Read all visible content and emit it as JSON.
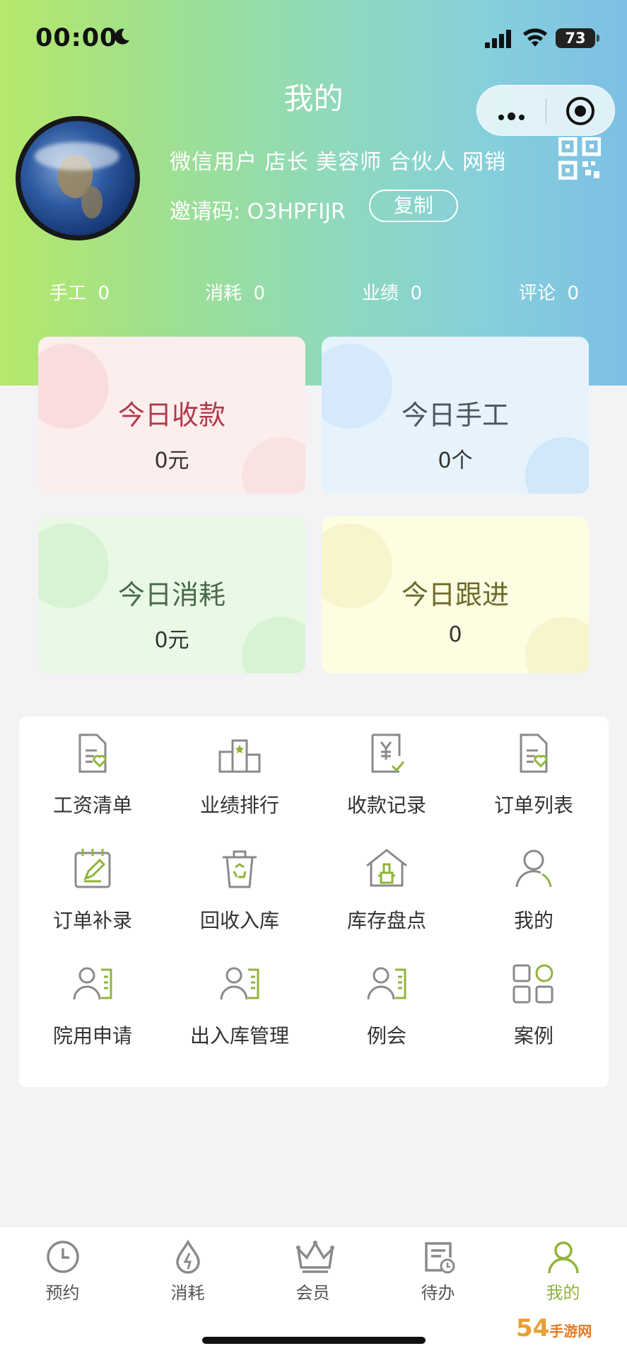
{
  "status_bar": {
    "time": "00:00",
    "battery": "73"
  },
  "header": {
    "title": "我的"
  },
  "profile": {
    "roles": "微信用户 店长 美容师 合伙人 网销",
    "invite_label": "邀请码: ",
    "invite_code": "O3HPFIJR",
    "copy_label": "复制"
  },
  "stats": [
    {
      "label": "手工",
      "value": "0"
    },
    {
      "label": "消耗",
      "value": "0"
    },
    {
      "label": "业绩",
      "value": "0"
    },
    {
      "label": "评论",
      "value": "0"
    }
  ],
  "cards": [
    {
      "title": "今日收款",
      "value": "0元",
      "color": "#b03a4a",
      "bg": "#fdeeee"
    },
    {
      "title": "今日手工",
      "value": "0个",
      "color": "#4a5560",
      "bg": "#e6f3fc"
    },
    {
      "title": "今日消耗",
      "value": "0元",
      "color": "#4a6a4a",
      "bg": "#e9f9e6"
    },
    {
      "title": "今日跟进",
      "value": "0",
      "color": "#6f6a2a",
      "bg": "#fdfde2"
    }
  ],
  "menu": [
    {
      "label": "工资清单",
      "icon": "doc-heart-icon"
    },
    {
      "label": "业绩排行",
      "icon": "podium-icon"
    },
    {
      "label": "收款记录",
      "icon": "yen-receipt-icon"
    },
    {
      "label": "订单列表",
      "icon": "doc-heart-icon"
    },
    {
      "label": "订单补录",
      "icon": "edit-notepad-icon"
    },
    {
      "label": "回收入库",
      "icon": "recycle-bin-icon"
    },
    {
      "label": "库存盘点",
      "icon": "warehouse-icon"
    },
    {
      "label": "我的",
      "icon": "user-icon"
    },
    {
      "label": "院用申请",
      "icon": "user-card-icon"
    },
    {
      "label": "出入库管理",
      "icon": "user-card-icon"
    },
    {
      "label": "例会",
      "icon": "user-card-icon"
    },
    {
      "label": "案例",
      "icon": "grid-apps-icon"
    }
  ],
  "tabs": [
    {
      "label": "预约",
      "icon": "clock-icon"
    },
    {
      "label": "消耗",
      "icon": "drop-bolt-icon"
    },
    {
      "label": "会员",
      "icon": "crown-icon"
    },
    {
      "label": "待办",
      "icon": "todo-icon"
    },
    {
      "label": "我的",
      "icon": "user-icon"
    }
  ],
  "colors": {
    "accent": "#8fb53b",
    "icon_gray": "#8a8a8a"
  },
  "watermark": {
    "main": "54",
    "sub": "手游网"
  }
}
